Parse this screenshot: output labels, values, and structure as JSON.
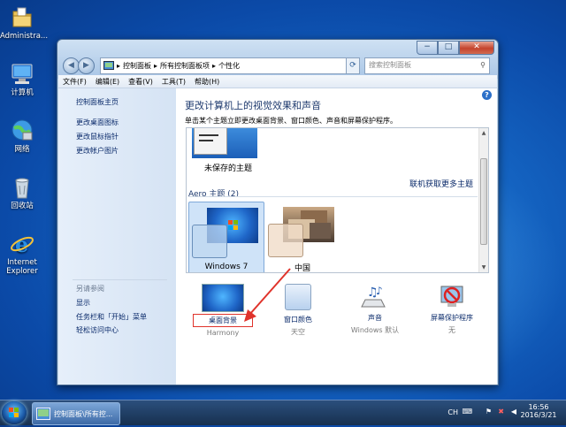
{
  "desktop": {
    "icons": [
      {
        "label": "Administra..."
      },
      {
        "label": "计算机"
      },
      {
        "label": "网络"
      },
      {
        "label": "回收站"
      },
      {
        "label": "Internet Explorer"
      }
    ]
  },
  "window": {
    "caption": {
      "min": "−",
      "max": "□",
      "close": "✕"
    },
    "breadcrumb": [
      "控制面板",
      "所有控制面板项",
      "个性化"
    ],
    "search_placeholder": "搜索控制面板",
    "menu": [
      "文件(F)",
      "编辑(E)",
      "查看(V)",
      "工具(T)",
      "帮助(H)"
    ],
    "left_pane": {
      "home": "控制面板主页",
      "links": [
        "更改桌面图标",
        "更改鼠标指针",
        "更改帐户图片"
      ],
      "see_also_title": "另请参阅",
      "see_also": [
        "显示",
        "任务栏和「开始」菜单",
        "轻松访问中心"
      ]
    },
    "heading": "更改计算机上的视觉效果和声音",
    "subheading": "单击某个主题立即更改桌面背景、窗口颜色、声音和屏幕保护程序。",
    "themes": {
      "unsaved_label": "未保存的主题",
      "get_more": "联机获取更多主题",
      "aero_group": "Aero 主题 (2)",
      "items": [
        {
          "name": "Windows 7",
          "selected": true
        },
        {
          "name": "中国",
          "selected": false
        }
      ]
    },
    "bottom": [
      {
        "label": "桌面背景",
        "value": "Harmony"
      },
      {
        "label": "窗口颜色",
        "value": "天空"
      },
      {
        "label": "声音",
        "value": "Windows 默认"
      },
      {
        "label": "屏幕保护程序",
        "value": "无"
      }
    ],
    "help": "?"
  },
  "taskbar": {
    "button_label": "控制面板\\所有控...",
    "tray": {
      "lang": "CH",
      "time": "16:56",
      "date": "2016/3/21"
    }
  },
  "colors": {
    "selection_red": "#e0332b",
    "link_blue": "#0a2a6a",
    "heading_blue": "#1e3a6e"
  }
}
